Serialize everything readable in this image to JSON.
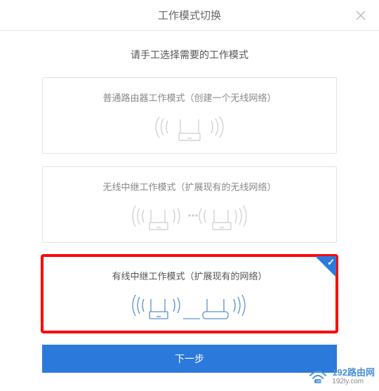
{
  "header": {
    "title": "工作模式切换"
  },
  "subtitle": "请手工选择需要的工作模式",
  "modes": {
    "normal": {
      "title": "普通路由器工作模式（创建一个无线网络）"
    },
    "wireless_relay": {
      "title": "无线中继工作模式（扩展现有的无线网络）"
    },
    "wired_relay": {
      "title": "有线中继工作模式（扩展现有的网络）"
    }
  },
  "next_button": "下一步",
  "watermark": {
    "brand": "192路由网",
    "url": "192ly.com"
  },
  "icons": {
    "close": "close-icon",
    "router": "router-icon",
    "signal": "signal-waves-icon",
    "wifi_small": "wifi-icon",
    "check": "check-icon"
  },
  "colors": {
    "accent": "#2b7adb",
    "highlight": "#ff0000",
    "muted": "#cccccc"
  }
}
